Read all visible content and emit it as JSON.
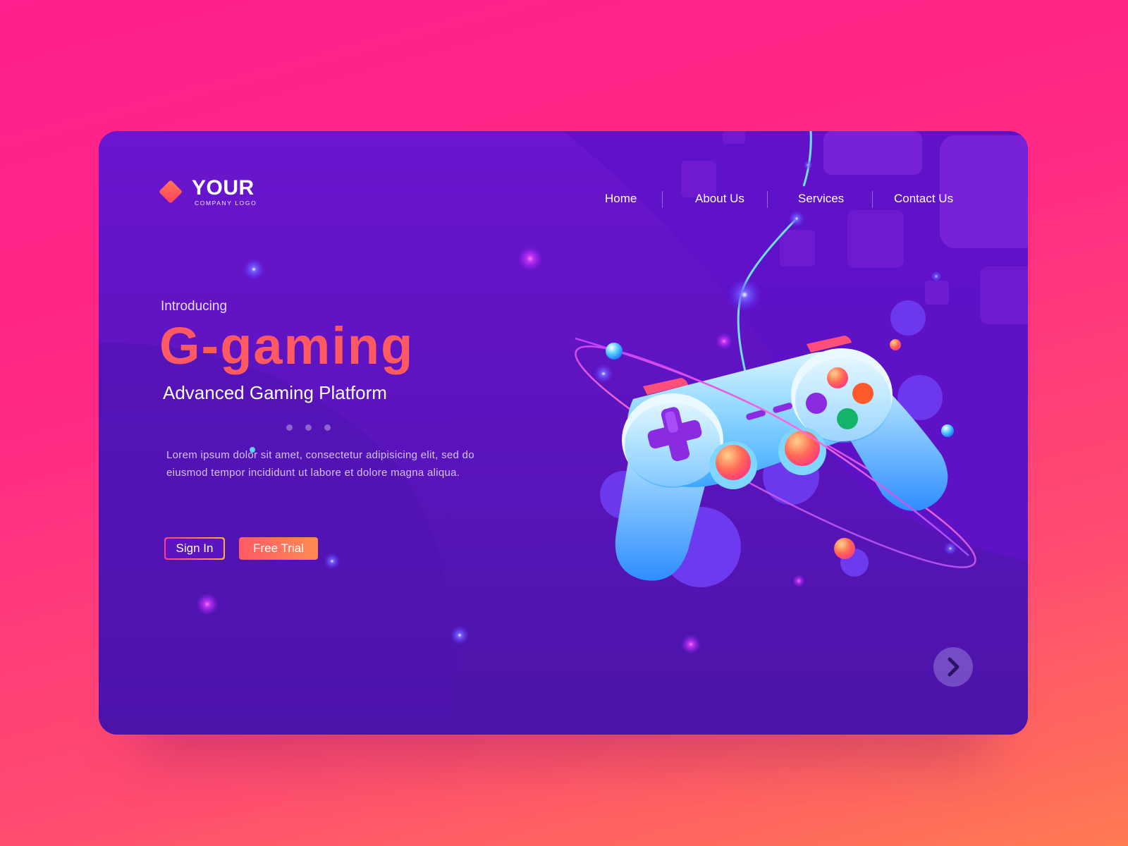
{
  "logo": {
    "main": "YOUR",
    "sub": "COMPANY LOGO"
  },
  "nav": {
    "items": [
      {
        "label": "Home"
      },
      {
        "label": "About Us"
      },
      {
        "label": "Services"
      },
      {
        "label": "Contact Us"
      }
    ]
  },
  "hero": {
    "intro": "Introducing",
    "title": "G-gaming",
    "subtitle": "Advanced Gaming Platform",
    "description": "Lorem ipsum dolor sit amet, consectetur adipisicing elit, sed do eiusmod tempor incididunt ut labore et dolore magna aliqua.",
    "slide_dots": 3
  },
  "buttons": {
    "sign_in": "Sign In",
    "free_trial": "Free Trial"
  },
  "icons": {
    "logo": "diamond-icon",
    "next": "chevron-right-icon",
    "illustration": "gamepad-icon"
  },
  "colors": {
    "accent": "#ff5a63",
    "card_bg": "#5a14bb",
    "page_bg": "#ff1f8c",
    "controller": "#6fc8ff"
  }
}
